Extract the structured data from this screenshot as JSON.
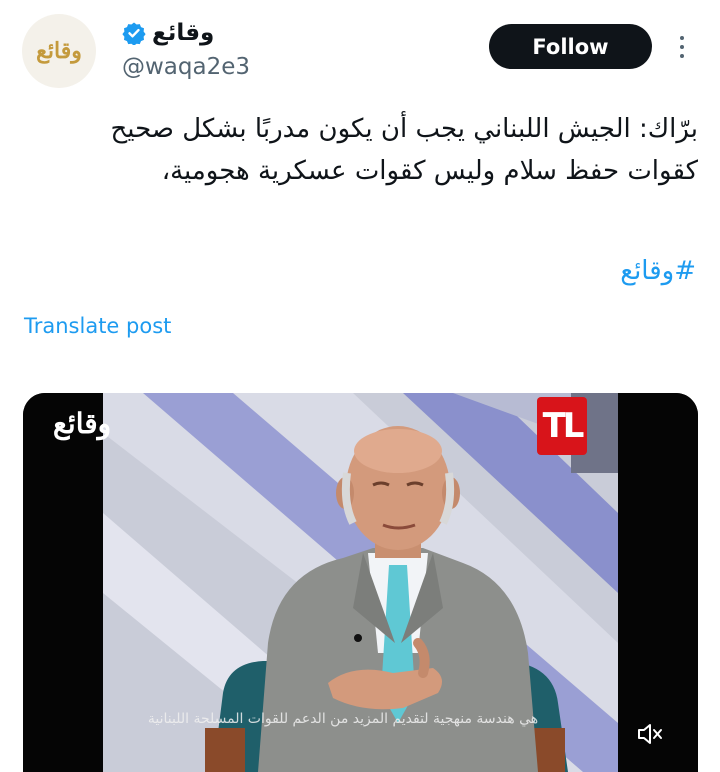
{
  "author": {
    "avatar_text": "وقائع",
    "display_name": "وقائع",
    "handle": "@waqa2e3",
    "verified": true,
    "verified_color": "#1d9bf0"
  },
  "actions": {
    "follow_label": "Follow"
  },
  "post": {
    "lines": [
      "برّاك: الجيش اللبناني يجب أن يكون مدربًا بشكل صحيح",
      "كقوات حفظ سلام وليس كقوات عسكرية هجومية،"
    ],
    "hashtag": "#وقائع",
    "translate_label": "Translate post"
  },
  "media": {
    "watermark": "وقائع",
    "channel_logo": "TL",
    "subtitle": "هي هندسة منهجية لتقديم المزيد من الدعم للقوات المسلحة اللبنانية",
    "mute_icon": "speaker-muted-icon"
  },
  "colors": {
    "link": "#1d9bf0",
    "follow_bg": "#0f1419",
    "channel_red": "#d8141a"
  }
}
